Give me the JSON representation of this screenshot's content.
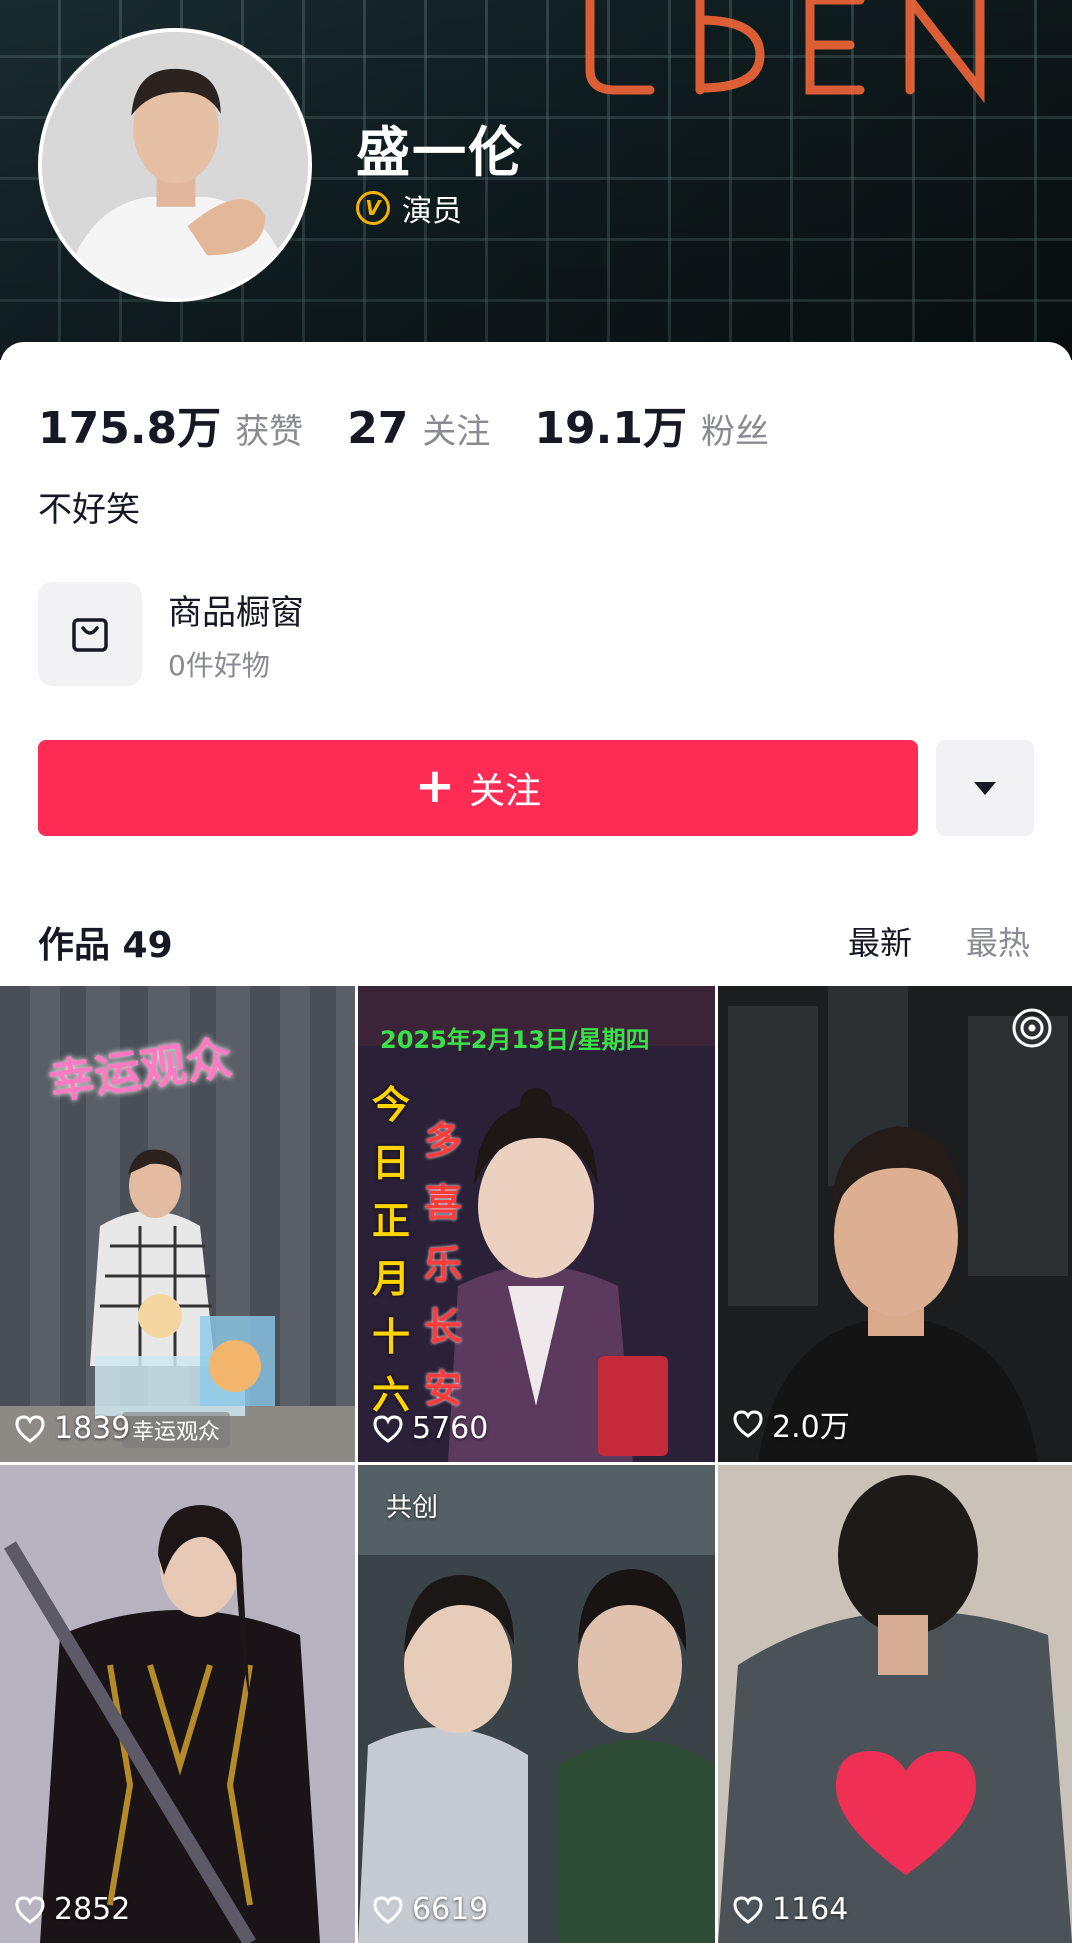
{
  "profile": {
    "name": "盛一伦",
    "verify_badge": "V",
    "verify_label": "演员",
    "bio": "不好笑"
  },
  "stats": [
    {
      "value": "175.8万",
      "label": "获赞"
    },
    {
      "value": "27",
      "label": "关注"
    },
    {
      "value": "19.1万",
      "label": "粉丝"
    }
  ],
  "shop": {
    "title": "商品橱窗",
    "subtitle": "0件好物",
    "icon": "shopping-bag-icon"
  },
  "actions": {
    "follow_plus": "+",
    "follow_label": "关注",
    "more_icon": "caret-down-icon"
  },
  "works": {
    "label": "作品 49",
    "sort_newest": "最新",
    "sort_hottest": "最热"
  },
  "videos": [
    {
      "likes": "1839",
      "overlay": "幸运观众",
      "caption": "幸运观众"
    },
    {
      "likes": "5760",
      "overlay_top": "2025年2月13日/星期四",
      "overlay_left": "今日正月十六",
      "overlay_mid": "多喜乐长安"
    },
    {
      "likes": "2.0万",
      "corner_icon": "live-icon"
    },
    {
      "likes": "2852"
    },
    {
      "likes": "6619",
      "tag": "共创"
    },
    {
      "likes": "1164"
    }
  ],
  "colors": {
    "accent": "#fe2c55",
    "verify": "#f1b300",
    "muted": "#8a8b91"
  }
}
